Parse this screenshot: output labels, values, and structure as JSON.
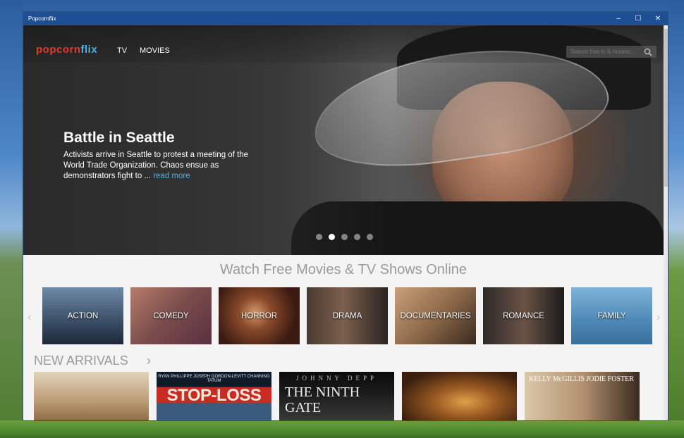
{
  "window": {
    "title": "Popcornflix",
    "controls": {
      "minimize": "–",
      "maximize": "☐",
      "close": "✕"
    }
  },
  "header": {
    "logo_part1": "popcorn",
    "logo_part2": "flix",
    "nav": {
      "tv": "TV",
      "movies": "MOVIES"
    },
    "search_placeholder": "Search free tv & movies..."
  },
  "hero": {
    "title": "Battle in Seattle",
    "description": "Activists arrive in Seattle to protest a meeting of the World Trade Organization. Chaos ensue as demonstrators fight to ...",
    "read_more": "read more",
    "slides_total": 5,
    "active_slide": 2
  },
  "tagline": "Watch Free Movies & TV Shows Online",
  "genres": [
    {
      "label": "ACTION"
    },
    {
      "label": "COMEDY"
    },
    {
      "label": "HORROR"
    },
    {
      "label": "DRAMA"
    },
    {
      "label": "DOCUMENTARIES"
    },
    {
      "label": "ROMANCE"
    },
    {
      "label": "FAMILY"
    }
  ],
  "carousel_arrows": {
    "left": "‹",
    "right": "›"
  },
  "new_arrivals": {
    "label": "NEW ARRIVALS",
    "chevron": "›",
    "posters": [
      {
        "top": "",
        "big": ""
      },
      {
        "top": "RYAN PHILLIPPE   JOSEPH GORDON-LEVITT   CHANNING TATUM",
        "big": "STOP-LOSS"
      },
      {
        "top": "JOHNNY DEPP",
        "big": "THE NINTH GATE"
      },
      {
        "top": "",
        "big": ""
      },
      {
        "top": "KELLY McGILLIS   JODIE FOSTER",
        "big": ""
      }
    ]
  },
  "colors": {
    "brand_red": "#e43a2b",
    "brand_blue": "#4db3e6",
    "titlebar": "#1f4f93"
  }
}
